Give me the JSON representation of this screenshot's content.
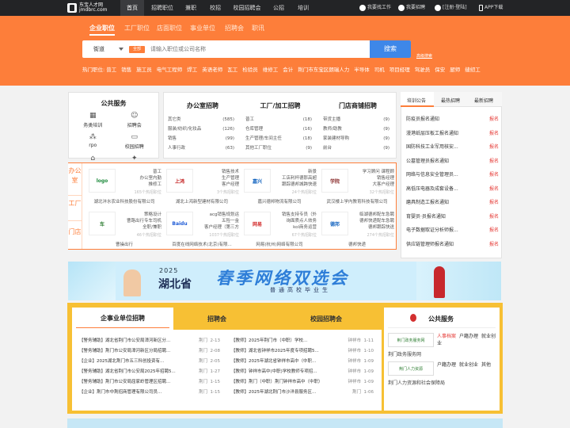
{
  "site": {
    "logo_title": "东宝人才网",
    "logo_sub": "jmdbrc.com"
  },
  "nav": {
    "items": [
      "首页",
      "招聘职位",
      "兼职",
      "校招",
      "校园招聘会",
      "公招",
      "培训"
    ]
  },
  "topright": {
    "find_job": "我要找工作",
    "recruit": "我要招聘",
    "login": "[注册·登陆]",
    "app": "APP下载"
  },
  "search_tabs": [
    "企业职位",
    "工厂职位",
    "店面职位",
    "事业单位",
    "招聘会",
    "职讯"
  ],
  "search": {
    "city": "街道",
    "type_tag": "全部",
    "placeholder": "请输入职位或公司名称",
    "button": "搜索",
    "advanced": "高级搜索"
  },
  "hot": {
    "label": "热门职位:",
    "items": [
      "普工",
      "销售",
      "施工员",
      "电气工程师",
      "焊工",
      "英语老师",
      "瓦工",
      "检验员",
      "维修工",
      "会计",
      "荆门市东宝区朗瑞人力",
      "半导体",
      "司机",
      "项目经理",
      "驾驶员",
      "保安",
      "厨师",
      "缝纫工"
    ]
  },
  "services": {
    "title": "公共服务",
    "items": [
      {
        "label": "务类培训",
        "icon": "book-icon",
        "glyph": "▦"
      },
      {
        "label": "招聘会",
        "icon": "people-icon",
        "glyph": "☺"
      },
      {
        "label": "rpo",
        "icon": "network-icon",
        "glyph": "⁂"
      },
      {
        "label": "校园招聘",
        "icon": "monitor-icon",
        "glyph": "▭"
      },
      {
        "label": "继续教育",
        "icon": "grad-cap-icon",
        "glyph": "⌂"
      },
      {
        "label": "猎头服务",
        "icon": "handshake-icon",
        "glyph": "✦"
      }
    ]
  },
  "categories": [
    {
      "title": "办公室招聘",
      "rows": [
        [
          "其它类",
          "(585)"
        ],
        [
          "服装/纺织/化妆品",
          "(126)"
        ],
        [
          "销售",
          "(99)"
        ],
        [
          "人事行政",
          "(63)"
        ]
      ]
    },
    {
      "title": "工厂/加工招聘",
      "rows": [
        [
          "普工",
          "(18)"
        ],
        [
          "仓库管理",
          "(16)"
        ],
        [
          "生产管理/车间主任",
          "(18)"
        ],
        [
          "其他工厂职位",
          "(9)"
        ]
      ]
    },
    {
      "title": "门店商铺招聘",
      "rows": [
        [
          "带货主播",
          "(9)"
        ],
        [
          "教师/助教",
          "(9)"
        ],
        [
          "家装建材导购",
          "(9)"
        ],
        [
          "前台",
          "(9)"
        ]
      ]
    }
  ],
  "announce": {
    "tabs": [
      "培训公告",
      "最热招聘",
      "最新招聘"
    ],
    "tag": "报名",
    "items": [
      "防疫员报名通知",
      "漫港纸层压板工报名通知",
      "国防科技工业军用核安...",
      "公墓管理员报名通知",
      "网络与信息安全管理员...",
      "高低压电器及成套设备...",
      "磨具制造工报名通知",
      "育婴员·员报名通知",
      "电子数据取证分析师报...",
      "供应链管理师报名通知"
    ]
  },
  "featured": {
    "side_labels": [
      "办公室",
      "工厂",
      "门店"
    ],
    "companies": [
      {
        "logo": "logo",
        "jobs": [
          "普工",
          "办公室内勤",
          "推修工"
        ],
        "count": "165个热招职位",
        "name": "湖北沣水农业科技股份有限公司"
      },
      {
        "logo": "上鸿",
        "jobs": [
          "销售技术",
          "生产管理",
          "客户经理"
        ],
        "count": "3个热招职位",
        "name": "湖北上鸿新型建材有限公司"
      },
      {
        "logo": "嘉兴",
        "jobs": [
          "新景",
          "工店利杯德那高超",
          "跟踪德邦城跨快速"
        ],
        "count": "24个热招职位",
        "name": "嘉兴德邦物流有限公司"
      },
      {
        "logo": "学院",
        "jobs": [
          "学习顾问 课程顾",
          "销售经理",
          "大客户经理"
        ],
        "count": "32个热招职位",
        "name": "武汉楼上学内教育科技有限公司"
      },
      {
        "logo": "车",
        "jobs": [
          "策略设计",
          "曹路出行专车司机",
          "全职/兼职"
        ],
        "count": "46个热招职位",
        "name": "曹操出行"
      },
      {
        "logo": "Baidu",
        "jobs": [
          "acg销售规划运",
          "五险一金",
          "客户经理（第三方"
        ],
        "count": "1037个热招职位",
        "name": "百度在线网络技术(北京)有限..."
      },
      {
        "logo": "网易",
        "jobs": [
          "销售支持专员（外",
          "询面质点人效务",
          "kol商务运营"
        ],
        "count": "67个热招职位",
        "name": "网易(杭州)网络有限公司"
      },
      {
        "logo": "德邦",
        "jobs": [
          "临湖德邦配车急聘",
          "德邦快递配车急聘",
          "德邦跟踪快送"
        ],
        "count": "274个热招职位",
        "name": "德邦快递"
      }
    ]
  },
  "spring": {
    "year": "2025",
    "province": "湖北省",
    "title": "春季网络双选会",
    "subtitle": "普通高校毕业生"
  },
  "lower": {
    "tabs": [
      "企事业单位招聘",
      "招聘会",
      "校园招聘会"
    ],
    "left_rows": [
      [
        "【警务辅助】湖北省荆门市公安局漳河新区分...",
        "荆门",
        "2-13"
      ],
      [
        "【警务辅助】荆门市公安局漳河新区分局招聘...",
        "荆门",
        "2-08"
      ],
      [
        "【企业】2025湖北荆门市五三科创投资有...",
        "荆门",
        "2-05"
      ],
      [
        "【警务辅助】湖北省荆门市公安局2025年招聘5...",
        "荆门",
        "1-27"
      ],
      [
        "【警务辅助】荆门市公安局屈家岭管理区招聘...",
        "荆门",
        "1-15"
      ],
      [
        "【企业】荆门市中荆招商管理有限公司员...",
        "荆门",
        "1-15"
      ]
    ],
    "right_rows": [
      [
        "【教师】2025年荆门市（中职）学校...",
        "钟祥市",
        "1-11"
      ],
      [
        "【教师】湖北省钟祥市2025年度专项招聘5...",
        "钟祥市",
        "1-10"
      ],
      [
        "【教师】2025年湖北省钟祥市高中（中职...",
        "钟祥市",
        "1-09"
      ],
      [
        "【教师】钟祥市高中(中职)学校教师专项招...",
        "钟祥市",
        "1-09"
      ],
      [
        "【教师】荆门（中职）荆门钟祥市高中（中职）",
        "钟祥市",
        "1-09"
      ],
      [
        "【教师】2025年湖北荆门市沙洋县服务区...",
        "荆门",
        "1-06"
      ]
    ],
    "public_title": "公共服务",
    "public_items": [
      {
        "logo": "荆门政务服务网",
        "links": [
          "人事档案",
          "户籍办理",
          "就业创业"
        ],
        "name": "荆门政务服务网"
      },
      {
        "logo": "荆门人力资源",
        "links": [
          "户籍办理",
          "就业创业",
          "其他"
        ],
        "name": "荆门人力资源和社会保障局"
      }
    ]
  },
  "colors": {
    "accent": "#fd7e3a",
    "nav_bg": "#232426",
    "search_btn": "#3e87e8",
    "yellow": "#f7c034",
    "red_tag": "#e53935"
  }
}
